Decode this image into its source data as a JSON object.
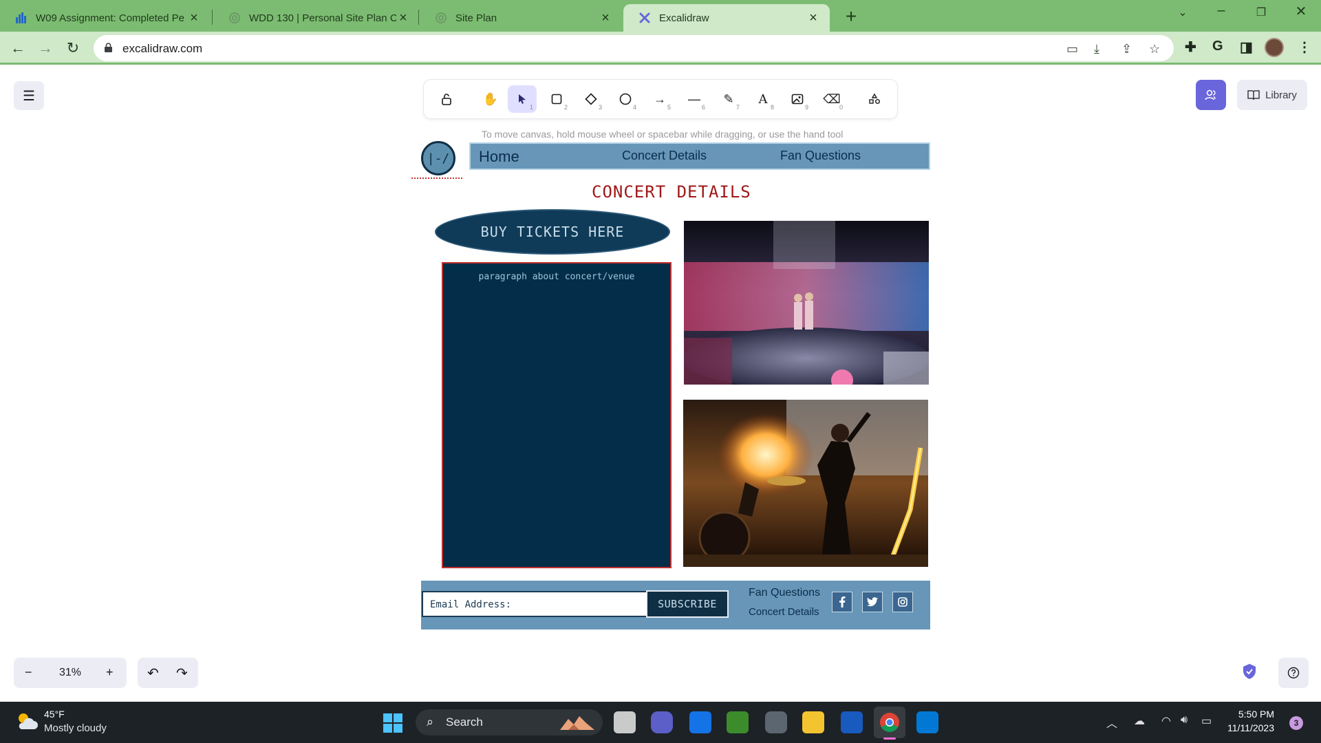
{
  "browser": {
    "tabs": [
      {
        "title": "W09 Assignment: Completed Pe",
        "favicon": "bar-chart-icon",
        "active": false
      },
      {
        "title": "WDD 130 | Personal Site Plan Co",
        "favicon": "spiral-icon",
        "active": false
      },
      {
        "title": "Site Plan",
        "favicon": "spiral-icon",
        "active": false
      },
      {
        "title": "Excalidraw",
        "favicon": "excalidraw-icon",
        "active": true
      }
    ],
    "url": "excalidraw.com",
    "colors": {
      "tab_strip": "#7cbc72",
      "toolbar": "#cfe9c9"
    }
  },
  "excalidraw": {
    "hint": "To move canvas, hold mouse wheel or spacebar while dragging, or use the hand tool",
    "tools": [
      {
        "name": "lock",
        "icon": "unlock-icon",
        "key": ""
      },
      {
        "name": "hand",
        "icon": "hand-icon",
        "key": ""
      },
      {
        "name": "selection",
        "icon": "pointer-icon",
        "key": "1"
      },
      {
        "name": "rectangle",
        "icon": "square-icon",
        "key": "2"
      },
      {
        "name": "diamond",
        "icon": "diamond-icon",
        "key": "3"
      },
      {
        "name": "ellipse",
        "icon": "circle-icon",
        "key": "4"
      },
      {
        "name": "arrow",
        "icon": "arrow-icon",
        "key": "5"
      },
      {
        "name": "line",
        "icon": "line-icon",
        "key": "6"
      },
      {
        "name": "draw",
        "icon": "pencil-icon",
        "key": "7"
      },
      {
        "name": "text",
        "icon": "text-icon",
        "key": "8"
      },
      {
        "name": "image",
        "icon": "image-icon",
        "key": "9"
      },
      {
        "name": "eraser",
        "icon": "eraser-icon",
        "key": "0"
      },
      {
        "name": "extra",
        "icon": "shapes-icon",
        "key": ""
      }
    ],
    "library_label": "Library",
    "zoom": "31%",
    "accent": "#6965db"
  },
  "wireframe": {
    "logo_text": "|-/",
    "nav": {
      "home": "Home",
      "concert": "Concert Details",
      "fans": "Fan Questions"
    },
    "heading": "CONCERT DETAILS",
    "buy_tickets": "BUY TICKETS HERE",
    "paragraph_placeholder": "paragraph about concert/venue",
    "email_placeholder": "Email Address:",
    "subscribe": "SUBSCRIBE",
    "footer_links": [
      "Fan Questions",
      "Concert Details"
    ],
    "social_icons": [
      "facebook-icon",
      "twitter-icon",
      "instagram-icon"
    ],
    "colors": {
      "navy": "#032d48",
      "steel_blue": "#6796b8",
      "heading_red": "#a01818"
    }
  },
  "taskbar": {
    "weather_temp": "45°F",
    "weather_desc": "Mostly cloudy",
    "search_label": "Search",
    "time": "5:50 PM",
    "date": "11/11/2023",
    "notifications": "3"
  }
}
